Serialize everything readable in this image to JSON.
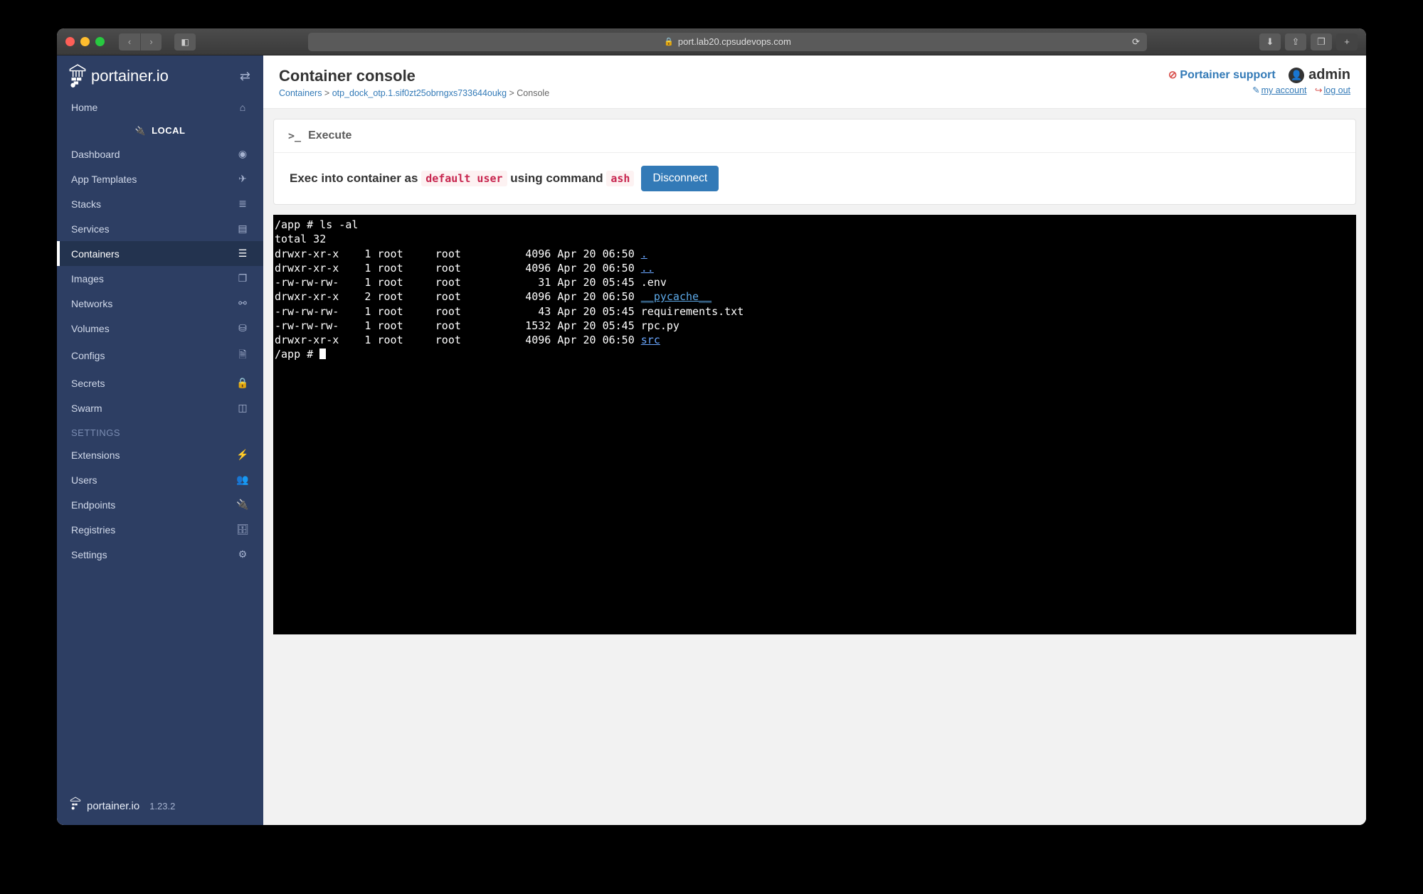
{
  "browser": {
    "url": "port.lab20.cpsudevops.com"
  },
  "sidebar": {
    "brand": "portainer.io",
    "version": "1.23.2",
    "home_label": "Home",
    "environment": "LOCAL",
    "items": [
      {
        "label": "Dashboard",
        "icon": "tachometer"
      },
      {
        "label": "App Templates",
        "icon": "rocket"
      },
      {
        "label": "Stacks",
        "icon": "list"
      },
      {
        "label": "Services",
        "icon": "clipboard"
      },
      {
        "label": "Containers",
        "icon": "server",
        "active": true
      },
      {
        "label": "Images",
        "icon": "clone"
      },
      {
        "label": "Networks",
        "icon": "sitemap"
      },
      {
        "label": "Volumes",
        "icon": "hdd"
      },
      {
        "label": "Configs",
        "icon": "file"
      },
      {
        "label": "Secrets",
        "icon": "lock"
      },
      {
        "label": "Swarm",
        "icon": "object-group"
      }
    ],
    "settings_label": "SETTINGS",
    "settings_items": [
      {
        "label": "Extensions",
        "icon": "bolt"
      },
      {
        "label": "Users",
        "icon": "users"
      },
      {
        "label": "Endpoints",
        "icon": "plug"
      },
      {
        "label": "Registries",
        "icon": "database"
      },
      {
        "label": "Settings",
        "icon": "cogs"
      }
    ]
  },
  "header": {
    "title": "Container console",
    "breadcrumb": {
      "root": "Containers",
      "container": "otp_dock_otp.1.sif0zt25obrngxs733644oukg",
      "leaf": "Console"
    },
    "support": "Portainer support",
    "admin": "admin",
    "my_account": "my account",
    "log_out": "log out"
  },
  "execute_panel": {
    "title": "Execute",
    "exec_text_pre": "Exec into container as ",
    "exec_user": "default user",
    "exec_text_mid": " using command ",
    "exec_cmd": "ash",
    "disconnect": "Disconnect"
  },
  "terminal": {
    "lines": [
      {
        "text": "/app # ls -al"
      },
      {
        "text": "total 32"
      },
      {
        "text": "drwxr-xr-x    1 root     root          4096 Apr 20 06:50 ",
        "tail": ".",
        "tailClass": "dir"
      },
      {
        "text": "drwxr-xr-x    1 root     root          4096 Apr 20 06:50 ",
        "tail": "..",
        "tailClass": "dir"
      },
      {
        "text": "-rw-rw-rw-    1 root     root            31 Apr 20 05:45 .env"
      },
      {
        "text": "drwxr-xr-x    2 root     root          4096 Apr 20 06:50 ",
        "tail": "__pycache__",
        "tailClass": "hl"
      },
      {
        "text": "-rw-rw-rw-    1 root     root            43 Apr 20 05:45 requirements.txt"
      },
      {
        "text": "-rw-rw-rw-    1 root     root          1532 Apr 20 05:45 rpc.py"
      },
      {
        "text": "drwxr-xr-x    1 root     root          4096 Apr 20 06:50 ",
        "tail": "src",
        "tailClass": "dir"
      }
    ],
    "prompt": "/app # "
  },
  "icons": {
    "tachometer": "◉",
    "rocket": "✈",
    "list": "≣",
    "clipboard": "▤",
    "server": "☰",
    "clone": "❐",
    "sitemap": "⚯",
    "hdd": "⛁",
    "file": "🗎",
    "lock": "🔒",
    "object-group": "◫",
    "bolt": "⚡",
    "users": "👥",
    "plug": "🔌",
    "database": "🗄",
    "cogs": "⚙",
    "home": "⌂"
  }
}
